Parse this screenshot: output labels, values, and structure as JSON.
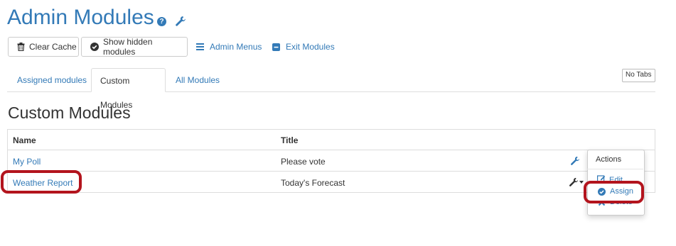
{
  "page": {
    "title": "Admin Modules",
    "section_heading": "Custom Modules"
  },
  "toolbar": {
    "clear_cache": "Clear Cache",
    "show_hidden": "Show hidden modules",
    "admin_menus": "Admin Menus",
    "exit_modules": "Exit Modules"
  },
  "tabs": [
    {
      "label": "Assigned modules",
      "active": false
    },
    {
      "label": "Custom Modules",
      "active": true
    },
    {
      "label": "All Modules",
      "active": false
    }
  ],
  "no_tabs_label": "No Tabs",
  "table": {
    "columns": [
      "Name",
      "Title"
    ],
    "rows": [
      {
        "name": "My Poll",
        "title": "Please vote"
      },
      {
        "name": "Weather Report",
        "title": "Today's Forecast"
      }
    ]
  },
  "actions_menu": {
    "header": "Actions",
    "items": [
      "Edit",
      "Assign",
      "Delete"
    ]
  },
  "colors": {
    "link": "#337ab7",
    "highlight": "#b3141d"
  }
}
